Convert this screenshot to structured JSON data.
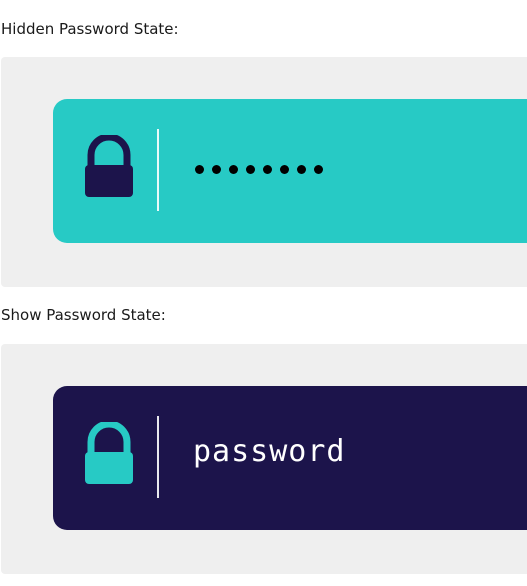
{
  "hidden_state": {
    "label": "Hidden Password State:",
    "field_bg": "#27cac5",
    "lock_color": "#1c144b",
    "masked_char_count": 8,
    "icon": "lock-icon"
  },
  "shown_state": {
    "label": "Show Password State:",
    "field_bg": "#1c144b",
    "lock_color": "#27cac5",
    "password_value": "password",
    "icon": "lock-icon"
  }
}
